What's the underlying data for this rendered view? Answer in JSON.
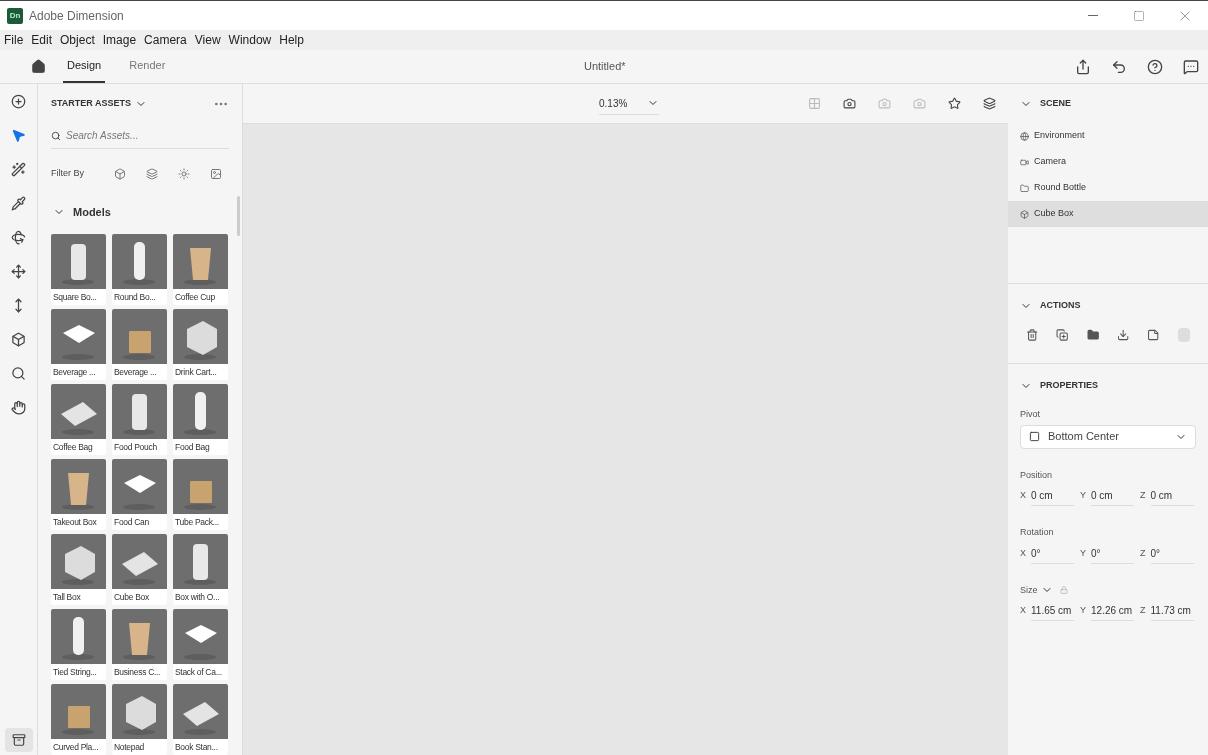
{
  "window": {
    "title": "Adobe Dimension",
    "logo": "Dn"
  },
  "menu": [
    "File",
    "Edit",
    "Object",
    "Image",
    "Camera",
    "View",
    "Window",
    "Help"
  ],
  "tabs": [
    {
      "label": "Design",
      "selected": true
    },
    {
      "label": "Render",
      "selected": false
    }
  ],
  "document_title": "Untitled*",
  "tools": [
    {
      "kind": "add",
      "selected": false
    },
    {
      "kind": "select",
      "selected": true
    },
    {
      "kind": "wand",
      "selected": false
    },
    {
      "kind": "eyedropper",
      "selected": false
    },
    {
      "kind": "orbit",
      "selected": false
    },
    {
      "kind": "pan",
      "selected": false
    },
    {
      "kind": "dolly",
      "selected": false
    },
    {
      "kind": "perspective",
      "selected": false
    },
    {
      "kind": "zoom",
      "selected": false
    },
    {
      "kind": "hand",
      "selected": false
    }
  ],
  "assets": {
    "title": "STARTER ASSETS",
    "search_placeholder": "Search Assets...",
    "filter_label": "Filter By",
    "section": "Models",
    "expanded": true,
    "items": [
      {
        "name": "Square Bo..."
      },
      {
        "name": "Round Bo..."
      },
      {
        "name": "Coffee Cup"
      },
      {
        "name": "Beverage ..."
      },
      {
        "name": "Beverage ..."
      },
      {
        "name": "Drink Cart..."
      },
      {
        "name": "Coffee Bag"
      },
      {
        "name": "Food Pouch"
      },
      {
        "name": "Food Bag"
      },
      {
        "name": "Takeout Box"
      },
      {
        "name": "Food Can"
      },
      {
        "name": "Tube Pack..."
      },
      {
        "name": "Tall Box"
      },
      {
        "name": "Cube Box"
      },
      {
        "name": "Box with O..."
      },
      {
        "name": "Tied String..."
      },
      {
        "name": "Business C..."
      },
      {
        "name": "Stack of Ca..."
      },
      {
        "name": "Curved Pla..."
      },
      {
        "name": "Notepad"
      },
      {
        "name": "Book Stan..."
      }
    ]
  },
  "zoom": "0.13%",
  "scene": {
    "title": "SCENE",
    "expanded": true,
    "items": [
      {
        "label": "Environment",
        "kind": "environment",
        "selected": false
      },
      {
        "label": "Camera",
        "kind": "camera",
        "selected": false
      },
      {
        "label": "Round Bottle",
        "kind": "group",
        "selected": false
      },
      {
        "label": "Cube Box",
        "kind": "model",
        "selected": true
      }
    ]
  },
  "actions": {
    "title": "ACTIONS",
    "expanded": true
  },
  "properties": {
    "title": "PROPERTIES",
    "expanded": true,
    "pivot_label": "Pivot",
    "pivot": "Bottom Center",
    "groups": [
      {
        "label": "Position",
        "fields": [
          {
            "axis": "X",
            "value": "0 cm"
          },
          {
            "axis": "Y",
            "value": "0 cm"
          },
          {
            "axis": "Z",
            "value": "0 cm"
          }
        ]
      },
      {
        "label": "Rotation",
        "fields": [
          {
            "axis": "X",
            "value": "0°"
          },
          {
            "axis": "Y",
            "value": "0°"
          },
          {
            "axis": "Z",
            "value": "0°"
          }
        ]
      },
      {
        "label": "Size",
        "locked": false,
        "fields": [
          {
            "axis": "X",
            "value": "11.65 cm"
          },
          {
            "axis": "Y",
            "value": "12.26 cm"
          },
          {
            "axis": "Z",
            "value": "11.73 cm"
          }
        ]
      }
    ]
  }
}
